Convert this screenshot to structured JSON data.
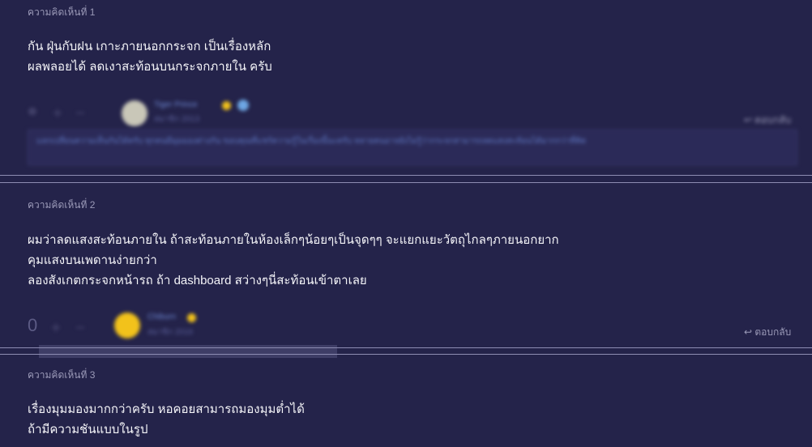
{
  "comments": [
    {
      "label": "ความคิดเห็นที่ 1",
      "lines": [
        "กัน ฝุ่นกับฝน เกาะภายนอกกระจก เป็นเรื่องหลัก",
        "ผลพลอยได้ ลดเงาสะท้อนบนกระจกภายใน ครับ"
      ],
      "vote_count": "",
      "user": {
        "name": "Tiger Prince",
        "meta": "สมาชิก 2013"
      },
      "reply_label": "ตอบกลับ",
      "quoted_reply": "แลกเปลี่ยนความเห็นกันได้ครับ ทุกคนมีมุมมองต่างกัน ขอบคุณที่แชร์ความรู้ในเรื่องนี้นะครับ หลายคนอาจยังไม่รู้ว่ากระจกสามารถลดแสงสะท้อนได้มากกว่าที่คิด",
      "colors": {
        "avatar": "#c9c7b8"
      }
    },
    {
      "label": "ความคิดเห็นที่ 2",
      "lines": [
        "ผมว่าลดแสงสะท้อนภายใน ถ้าสะท้อนภายในห้องเล็กๆน้อยๆเป็นจุดๆๆ จะแยกแยะวัตถุไกลๆภายนอกยาก",
        "คุมแสงบนเพดานง่ายกว่า",
        "ลองสังเกตกระจกหน้ารถ ถ้า dashboard สว่างๆนี่สะท้อนเข้าตาเลย"
      ],
      "vote_count": "0",
      "user": {
        "name": "Chiburn",
        "meta": "สมาชิก 2016"
      },
      "reply_label": "ตอบกลับ",
      "colors": {
        "avatar": "#f2c21b"
      }
    },
    {
      "label": "ความคิดเห็นที่ 3",
      "lines": [
        "เรื่องมุมมองมากกว่าครับ หอคอยสามารถมองมุมต่ำได้",
        "ถ้ามีความชันแบบในรูป"
      ]
    }
  ],
  "icons": {
    "vote_up": "plus-icon",
    "vote_down": "minus-icon",
    "reply": "reply-arrow-icon"
  },
  "theme": {
    "background": "#24234a",
    "divider": "#8e8db3",
    "label": "#9b9ab8"
  }
}
